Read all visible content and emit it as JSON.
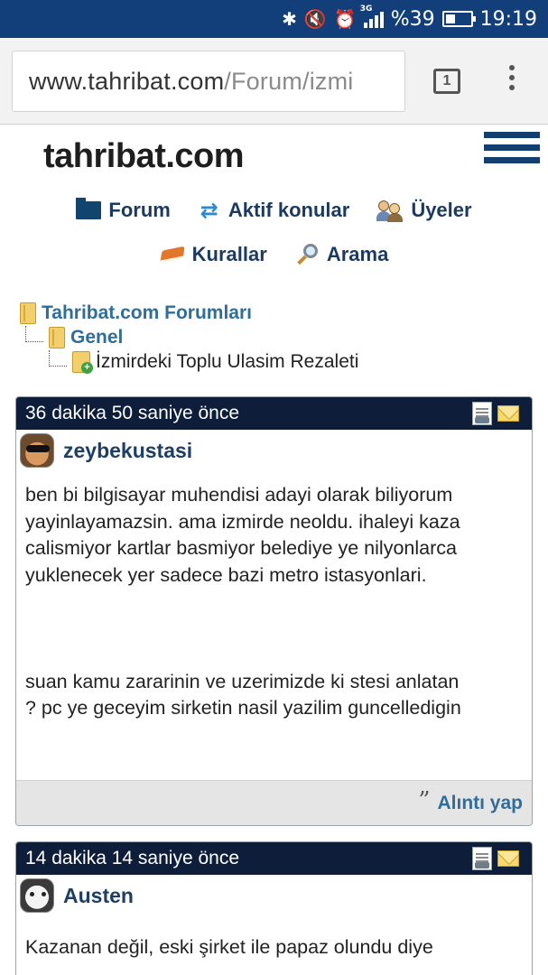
{
  "status_bar": {
    "network": "3G",
    "battery_text": "%39",
    "battery_level": 0.39,
    "time": "19:19",
    "icons": [
      "bluetooth-icon",
      "mute-icon",
      "alarm-icon",
      "signal-icon",
      "battery-icon"
    ]
  },
  "browser": {
    "url_host": "www.tahribat.com",
    "url_path": "/Forum/izmi",
    "tab_count": "1"
  },
  "site": {
    "logo": "tahribat.com"
  },
  "nav": {
    "forum": "Forum",
    "active": "Aktif konular",
    "members": "Üyeler",
    "rules": "Kurallar",
    "search": "Arama"
  },
  "breadcrumb": {
    "root": "Tahribat.com Forumları",
    "category": "Genel",
    "topic": "İzmirdeki Toplu Ulasim Rezaleti"
  },
  "posts": [
    {
      "time": "36 dakika 50 saniye önce",
      "user": "zeybekustasi",
      "lines": [
        "ben bi bilgisayar muhendisi adayi olarak biliyorum",
        "yayinlayamazsin. ama izmirde neoldu. ihaleyi kaza",
        "calismiyor kartlar basmiyor belediye ye nilyonlarca",
        "yuklenecek yer sadece bazi metro istasyonlari.",
        "",
        "",
        "",
        "suan kamu zararinin ve uzerimizde ki stesi anlatan",
        "? pc ye geceyim sirketin nasil yazilim guncelledigin"
      ],
      "quote": "Alıntı yap"
    },
    {
      "time": "14 dakika 14 saniye önce",
      "user": "Austen",
      "lines": [
        "Kazanan değil, eski şirket ile papaz olundu diye"
      ]
    }
  ],
  "colors": {
    "status_bar": "#123e79",
    "post_header": "#0d1d3a",
    "link": "#2f6d9a",
    "username": "#1d3f66"
  }
}
